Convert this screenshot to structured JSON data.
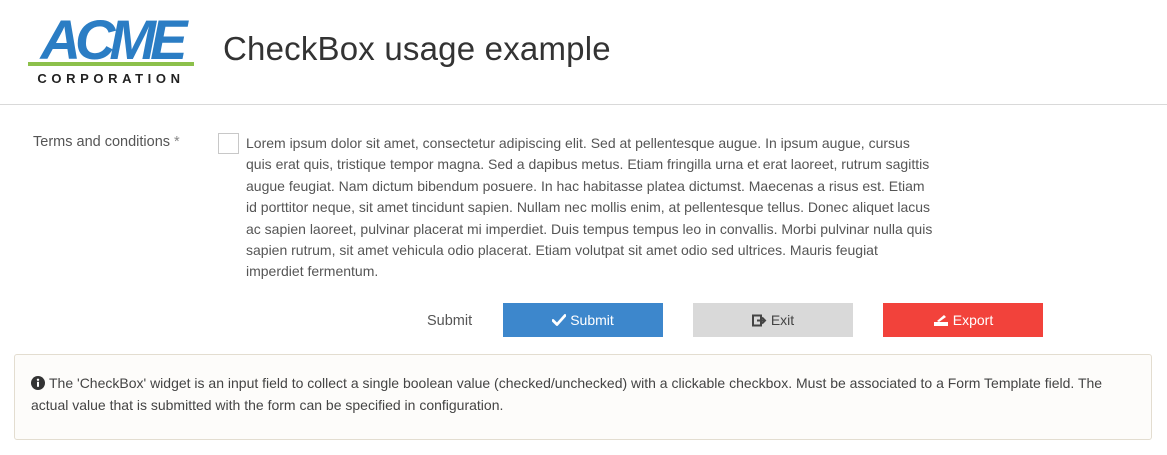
{
  "brand": {
    "logo_word": "ACME",
    "logo_sub": "CORPORATION",
    "colors": {
      "logo_blue": "#2b7dc4",
      "logo_green": "#8cc04b"
    }
  },
  "page": {
    "title": "CheckBox usage example"
  },
  "form": {
    "field_label": "Terms and conditions",
    "required_marker": "*",
    "checkbox_checked": false,
    "terms_text": "Lorem ipsum dolor sit amet, consectetur adipiscing elit. Sed at pellentesque augue. In ipsum augue, cursus quis erat quis, tristique tempor magna. Sed a dapibus metus. Etiam fringilla urna et erat laoreet, rutrum sagittis augue feugiat. Nam dictum bibendum posuere. In hac habitasse platea dictumst. Maecenas a risus est. Etiam id porttitor neque, sit amet tincidunt sapien. Nullam nec mollis enim, at pellentesque tellus. Donec aliquet lacus ac sapien laoreet, pulvinar placerat mi imperdiet. Duis tempus tempus leo in convallis. Morbi pulvinar nulla quis sapien rutrum, sit amet vehicula odio placerat. Etiam volutpat sit amet odio sed ultrices. Mauris feugiat imperdiet fermentum."
  },
  "actions": {
    "submit_row_label": "Submit",
    "submit_button": "Submit",
    "exit_button": "Exit",
    "export_button": "Export",
    "colors": {
      "submit": "#3d87cc",
      "exit": "#d9d9d9",
      "export": "#f2423b"
    }
  },
  "info": {
    "prefix": "The '",
    "widget_name": "CheckBox",
    "text": "' widget is an input field to collect a single boolean value (checked/unchecked) with a clickable checkbox. Must be associated to a Form Template field. The actual value that is submitted with the form can be specified in configuration."
  },
  "icons": {
    "submit": "check-icon",
    "exit": "sign-out-icon",
    "export": "export-icon",
    "info": "info-circle-icon"
  }
}
